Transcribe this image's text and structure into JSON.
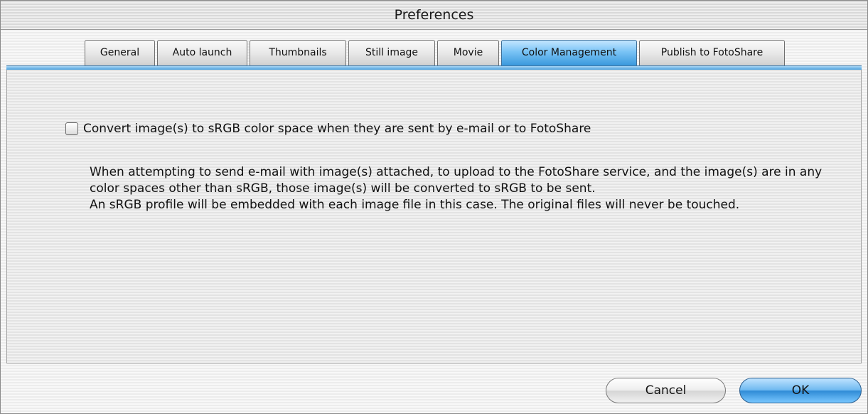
{
  "window": {
    "title": "Preferences"
  },
  "tabs": [
    {
      "label": "General",
      "selected": false
    },
    {
      "label": "Auto launch",
      "selected": false
    },
    {
      "label": "Thumbnails",
      "selected": false
    },
    {
      "label": "Still image",
      "selected": false
    },
    {
      "label": "Movie",
      "selected": false
    },
    {
      "label": "Color Management",
      "selected": true
    },
    {
      "label": "Publish to FotoShare",
      "selected": false
    }
  ],
  "panel": {
    "checkbox": {
      "label": "Convert image(s) to sRGB color space when they are sent by e-mail or to FotoShare",
      "checked": false
    },
    "description": {
      "paragraph1": "When attempting to send e-mail with image(s) attached, to upload to the FotoShare service, and the image(s) are in any color spaces other than sRGB, those image(s) will be converted to sRGB to be sent.",
      "paragraph2": "An sRGB profile will be embedded with each image file in this case. The original files will never be touched."
    }
  },
  "buttons": {
    "cancel_label": "Cancel",
    "ok_label": "OK"
  },
  "colors": {
    "accent": "#4a9fdc"
  }
}
